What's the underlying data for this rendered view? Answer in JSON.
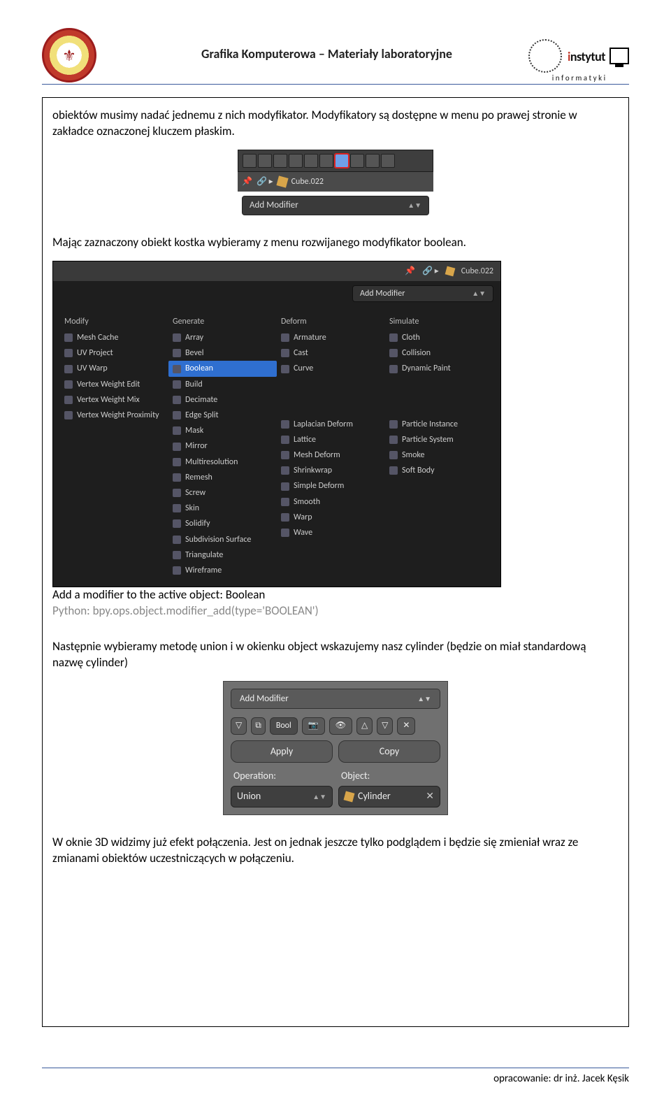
{
  "header": {
    "title": "Grafika Komputerowa – Materiały laboratoryjne",
    "inst_name": "nstytut",
    "inst_sub": "i n f o r m a t y k i"
  },
  "body": {
    "p1": "obiektów musimy nadać jednemu z nich modyfikator. Modyfikatory są dostępne w menu po prawej stronie w zakładce oznaczonej kluczem płaskim.",
    "p2": "Mając zaznaczony obiekt kostka wybieramy z menu rozwijanego modyfikator boolean.",
    "p3": "Następnie wybieramy metodę union i w okienku object wskazujemy nasz cylinder (będzie on miał standardową nazwę cylinder)",
    "p4": "W oknie 3D widzimy już efekt połączenia. Jest on jednak jeszcze tylko podglądem i będzie się zmieniał wraz ze zmianami obiektów uczestniczących w połączeniu."
  },
  "shot1": {
    "cube_label": "Cube.022",
    "add_modifier": "Add Modifier"
  },
  "shot2": {
    "cube_label": "Cube.022",
    "add_modifier": "Add Modifier",
    "tooltip_line1": "Add a modifier to the active object: Boolean",
    "tooltip_line2": "Python: bpy.ops.object.modifier_add(type='BOOLEAN')",
    "cols": {
      "modify": {
        "head": "Modify",
        "items": [
          "Mesh Cache",
          "UV Project",
          "UV Warp",
          "Vertex Weight Edit",
          "Vertex Weight Mix",
          "Vertex Weight Proximity"
        ]
      },
      "generate": {
        "head": "Generate",
        "items": [
          "Array",
          "Bevel",
          "Boolean",
          "Build",
          "Decimate",
          "Edge Split",
          "Mask",
          "Mirror",
          "Multiresolution",
          "Remesh",
          "Screw",
          "Skin",
          "Solidify",
          "Subdivision Surface",
          "Triangulate",
          "Wireframe"
        ]
      },
      "deform": {
        "head": "Deform",
        "items": [
          "Armature",
          "Cast",
          "Curve",
          "",
          "",
          "",
          "Laplacian Deform",
          "Lattice",
          "Mesh Deform",
          "Shrinkwrap",
          "Simple Deform",
          "Smooth",
          "Warp",
          "Wave"
        ]
      },
      "simulate": {
        "head": "Simulate",
        "items": [
          "Cloth",
          "Collision",
          "Dynamic Paint",
          "",
          "",
          "",
          "Particle Instance",
          "Particle System",
          "Smoke",
          "Soft Body"
        ]
      }
    }
  },
  "shot3": {
    "add_modifier": "Add Modifier",
    "bool": "Bool",
    "apply": "Apply",
    "copy": "Copy",
    "operation_label": "Operation:",
    "object_label": "Object:",
    "operation_value": "Union",
    "object_value": "Cylinder"
  },
  "footer": {
    "text": "opracowanie: dr inż. Jacek Kęsik"
  }
}
